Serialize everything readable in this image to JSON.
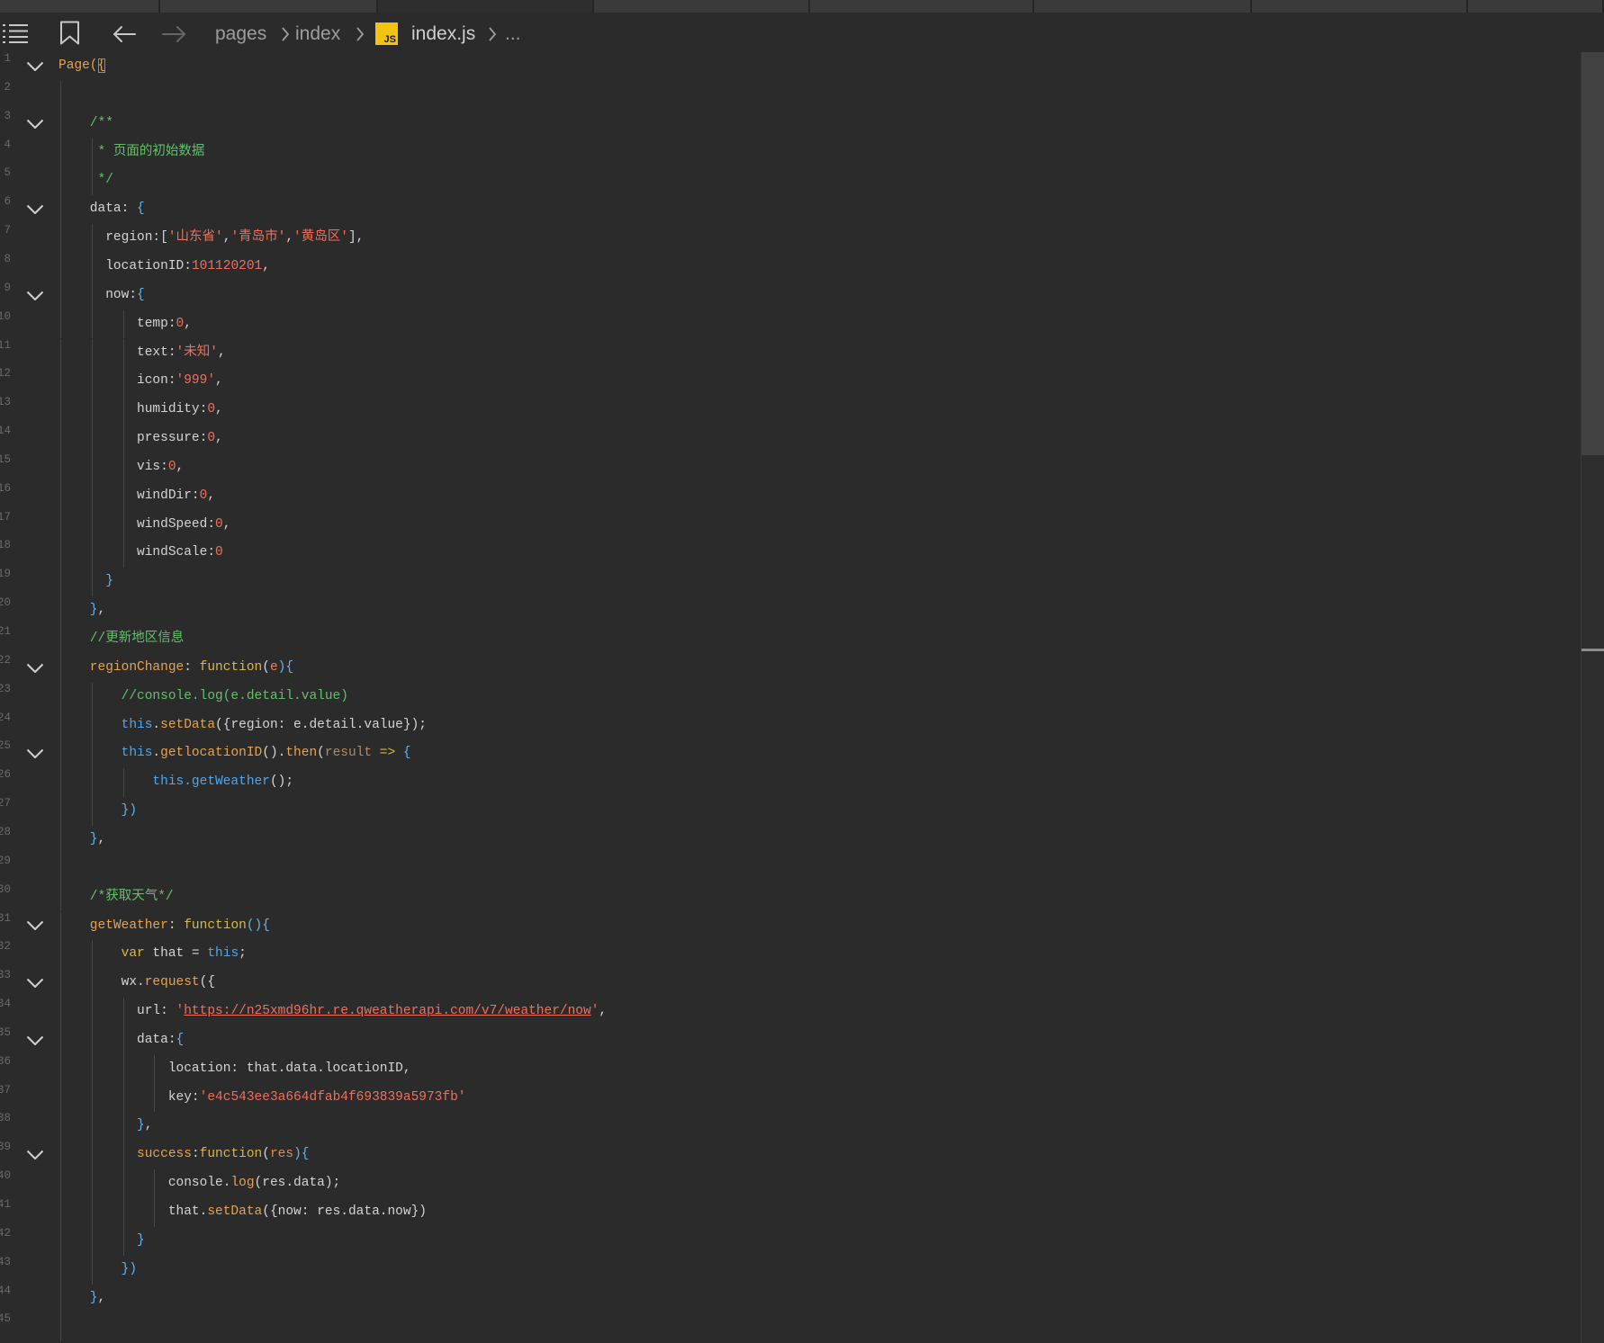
{
  "toolbar": {
    "outline_icon": "list-icon",
    "bookmark_icon": "bookmark-icon",
    "back_icon": "arrow-left-icon",
    "forward_icon": "arrow-right-icon",
    "forward_enabled": false
  },
  "breadcrumb": {
    "segments": [
      "pages",
      "index",
      "index.js",
      "..."
    ],
    "file_badge": "JS",
    "separator_icon": "chevron-right-icon"
  },
  "theme": {
    "background": "#2b2b2b",
    "plain": "#d4d4d4",
    "function": "#e5a350",
    "keyword": "#d9b64c",
    "this": "#4ea6f0",
    "brace": "#62b4ec",
    "string": "#ef6f5e",
    "comment": "#63c06a",
    "param": "#de8a5c",
    "dim": "#b08a62",
    "line_number": "#6a6a6a",
    "js_badge": "#f1c40f"
  },
  "editor": {
    "lines": [
      {
        "n": "1",
        "fold": true,
        "tokens": [
          {
            "t": "Page(",
            "k": "fn"
          },
          {
            "t": "{",
            "k": "match"
          }
        ]
      },
      {
        "n": "2",
        "tokens": []
      },
      {
        "n": "3",
        "fold": true,
        "tokens": [
          {
            "t": "    /**",
            "k": "cmt"
          }
        ]
      },
      {
        "n": "4",
        "tokens": [
          {
            "t": "     * 页面的初始数据",
            "k": "cmt"
          }
        ]
      },
      {
        "n": "5",
        "tokens": [
          {
            "t": "     */",
            "k": "cmt"
          }
        ]
      },
      {
        "n": "6",
        "fold": true,
        "tokens": [
          {
            "t": "    data: ",
            "k": "plain"
          },
          {
            "t": "{",
            "k": "brace"
          }
        ]
      },
      {
        "n": "7",
        "tokens": [
          {
            "t": "      region:[",
            "k": "plain"
          },
          {
            "t": "'山东省'",
            "k": "str"
          },
          {
            "t": ",",
            "k": "plain"
          },
          {
            "t": "'青岛市'",
            "k": "str"
          },
          {
            "t": ",",
            "k": "plain"
          },
          {
            "t": "'黄岛区'",
            "k": "str"
          },
          {
            "t": "],",
            "k": "plain"
          }
        ]
      },
      {
        "n": "8",
        "tokens": [
          {
            "t": "      locationID:",
            "k": "plain"
          },
          {
            "t": "101120201",
            "k": "str"
          },
          {
            "t": ",",
            "k": "plain"
          }
        ]
      },
      {
        "n": "9",
        "fold": true,
        "tokens": [
          {
            "t": "      now:",
            "k": "plain"
          },
          {
            "t": "{",
            "k": "brace"
          }
        ]
      },
      {
        "n": "10",
        "tokens": [
          {
            "t": "          temp:",
            "k": "plain"
          },
          {
            "t": "0",
            "k": "str"
          },
          {
            "t": ",",
            "k": "plain"
          }
        ]
      },
      {
        "n": "11",
        "tokens": [
          {
            "t": "          text:",
            "k": "plain"
          },
          {
            "t": "'未知'",
            "k": "str"
          },
          {
            "t": ",",
            "k": "plain"
          }
        ]
      },
      {
        "n": "12",
        "tokens": [
          {
            "t": "          icon:",
            "k": "plain"
          },
          {
            "t": "'999'",
            "k": "str"
          },
          {
            "t": ",",
            "k": "plain"
          }
        ]
      },
      {
        "n": "13",
        "tokens": [
          {
            "t": "          humidity:",
            "k": "plain"
          },
          {
            "t": "0",
            "k": "str"
          },
          {
            "t": ",",
            "k": "plain"
          }
        ]
      },
      {
        "n": "14",
        "tokens": [
          {
            "t": "          pressure:",
            "k": "plain"
          },
          {
            "t": "0",
            "k": "str"
          },
          {
            "t": ",",
            "k": "plain"
          }
        ]
      },
      {
        "n": "15",
        "tokens": [
          {
            "t": "          vis:",
            "k": "plain"
          },
          {
            "t": "0",
            "k": "str"
          },
          {
            "t": ",",
            "k": "plain"
          }
        ]
      },
      {
        "n": "16",
        "tokens": [
          {
            "t": "          windDir:",
            "k": "plain"
          },
          {
            "t": "0",
            "k": "str"
          },
          {
            "t": ",",
            "k": "plain"
          }
        ]
      },
      {
        "n": "17",
        "tokens": [
          {
            "t": "          windSpeed:",
            "k": "plain"
          },
          {
            "t": "0",
            "k": "str"
          },
          {
            "t": ",",
            "k": "plain"
          }
        ]
      },
      {
        "n": "18",
        "tokens": [
          {
            "t": "          windScale:",
            "k": "plain"
          },
          {
            "t": "0",
            "k": "str"
          }
        ]
      },
      {
        "n": "19",
        "tokens": [
          {
            "t": "      }",
            "k": "brace"
          }
        ]
      },
      {
        "n": "20",
        "tokens": [
          {
            "t": "    }",
            "k": "brace"
          },
          {
            "t": ",",
            "k": "plain"
          }
        ]
      },
      {
        "n": "21",
        "tokens": [
          {
            "t": "    //更新地区信息",
            "k": "cmt"
          }
        ]
      },
      {
        "n": "22",
        "fold": true,
        "tokens": [
          {
            "t": "    regionChange",
            "k": "fn"
          },
          {
            "t": ": ",
            "k": "plain"
          },
          {
            "t": "function",
            "k": "kw"
          },
          {
            "t": "(",
            "k": "plain"
          },
          {
            "t": "e",
            "k": "param"
          },
          {
            "t": "){",
            "k": "brace"
          }
        ]
      },
      {
        "n": "23",
        "tokens": [
          {
            "t": "        //console.log(e.detail.value)",
            "k": "cmt"
          }
        ]
      },
      {
        "n": "24",
        "tokens": [
          {
            "t": "        this",
            "k": "this"
          },
          {
            "t": ".",
            "k": "plain"
          },
          {
            "t": "setData",
            "k": "fn"
          },
          {
            "t": "({region: e.detail.value});",
            "k": "plain"
          }
        ]
      },
      {
        "n": "25",
        "fold": true,
        "tokens": [
          {
            "t": "        this",
            "k": "this"
          },
          {
            "t": ".",
            "k": "plain"
          },
          {
            "t": "getlocationID",
            "k": "fn"
          },
          {
            "t": "().",
            "k": "plain"
          },
          {
            "t": "then",
            "k": "fn"
          },
          {
            "t": "(",
            "k": "plain"
          },
          {
            "t": "result",
            "k": "dim"
          },
          {
            "t": " => ",
            "k": "kw"
          },
          {
            "t": "{",
            "k": "brace"
          }
        ]
      },
      {
        "n": "26",
        "tokens": [
          {
            "t": "            this.getWeather",
            "k": "this"
          },
          {
            "t": "();",
            "k": "plain"
          }
        ]
      },
      {
        "n": "27",
        "tokens": [
          {
            "t": "        })",
            "k": "brace"
          }
        ]
      },
      {
        "n": "28",
        "tokens": [
          {
            "t": "    }",
            "k": "brace"
          },
          {
            "t": ",",
            "k": "plain"
          }
        ]
      },
      {
        "n": "29",
        "tokens": []
      },
      {
        "n": "30",
        "tokens": [
          {
            "t": "    /*获取天气*/",
            "k": "cmt"
          }
        ]
      },
      {
        "n": "31",
        "fold": true,
        "tokens": [
          {
            "t": "    getWeather",
            "k": "fn"
          },
          {
            "t": ": ",
            "k": "plain"
          },
          {
            "t": "function",
            "k": "kw"
          },
          {
            "t": "(){",
            "k": "brace"
          }
        ]
      },
      {
        "n": "32",
        "tokens": [
          {
            "t": "        var",
            "k": "kw"
          },
          {
            "t": " that = ",
            "k": "plain"
          },
          {
            "t": "this",
            "k": "this"
          },
          {
            "t": ";",
            "k": "plain"
          }
        ]
      },
      {
        "n": "33",
        "fold": true,
        "tokens": [
          {
            "t": "        wx.",
            "k": "plain"
          },
          {
            "t": "request",
            "k": "fn"
          },
          {
            "t": "({",
            "k": "plain"
          }
        ]
      },
      {
        "n": "34",
        "tokens": [
          {
            "t": "          url: ",
            "k": "plain"
          },
          {
            "t": "'",
            "k": "str"
          },
          {
            "t": "https://n25xmd96hr.re.qweatherapi.com/v7/weather/now",
            "k": "link"
          },
          {
            "t": "'",
            "k": "str"
          },
          {
            "t": ",",
            "k": "plain"
          }
        ]
      },
      {
        "n": "35",
        "fold": true,
        "tokens": [
          {
            "t": "          data:",
            "k": "plain"
          },
          {
            "t": "{",
            "k": "brace"
          }
        ]
      },
      {
        "n": "36",
        "tokens": [
          {
            "t": "              location: that.data.locationID,",
            "k": "plain"
          }
        ]
      },
      {
        "n": "37",
        "tokens": [
          {
            "t": "              key:",
            "k": "plain"
          },
          {
            "t": "'e4c543ee3a664dfab4f693839a5973fb'",
            "k": "str"
          }
        ]
      },
      {
        "n": "38",
        "tokens": [
          {
            "t": "          }",
            "k": "brace"
          },
          {
            "t": ",",
            "k": "plain"
          }
        ]
      },
      {
        "n": "39",
        "fold": true,
        "tokens": [
          {
            "t": "          success",
            "k": "fn"
          },
          {
            "t": ":",
            "k": "plain"
          },
          {
            "t": "function",
            "k": "kw"
          },
          {
            "t": "(",
            "k": "plain"
          },
          {
            "t": "res",
            "k": "param"
          },
          {
            "t": "){",
            "k": "brace"
          }
        ]
      },
      {
        "n": "40",
        "tokens": [
          {
            "t": "              console.",
            "k": "plain"
          },
          {
            "t": "log",
            "k": "fn"
          },
          {
            "t": "(res.data);",
            "k": "plain"
          }
        ]
      },
      {
        "n": "41",
        "tokens": [
          {
            "t": "              that.",
            "k": "plain"
          },
          {
            "t": "setData",
            "k": "fn"
          },
          {
            "t": "({now: res.data.now})",
            "k": "plain"
          }
        ]
      },
      {
        "n": "42",
        "tokens": [
          {
            "t": "          }",
            "k": "brace"
          }
        ]
      },
      {
        "n": "43",
        "tokens": [
          {
            "t": "        })",
            "k": "brace"
          }
        ]
      },
      {
        "n": "44",
        "tokens": [
          {
            "t": "    }",
            "k": "brace"
          },
          {
            "t": ",",
            "k": "plain"
          }
        ]
      },
      {
        "n": "45",
        "tokens": []
      }
    ]
  }
}
